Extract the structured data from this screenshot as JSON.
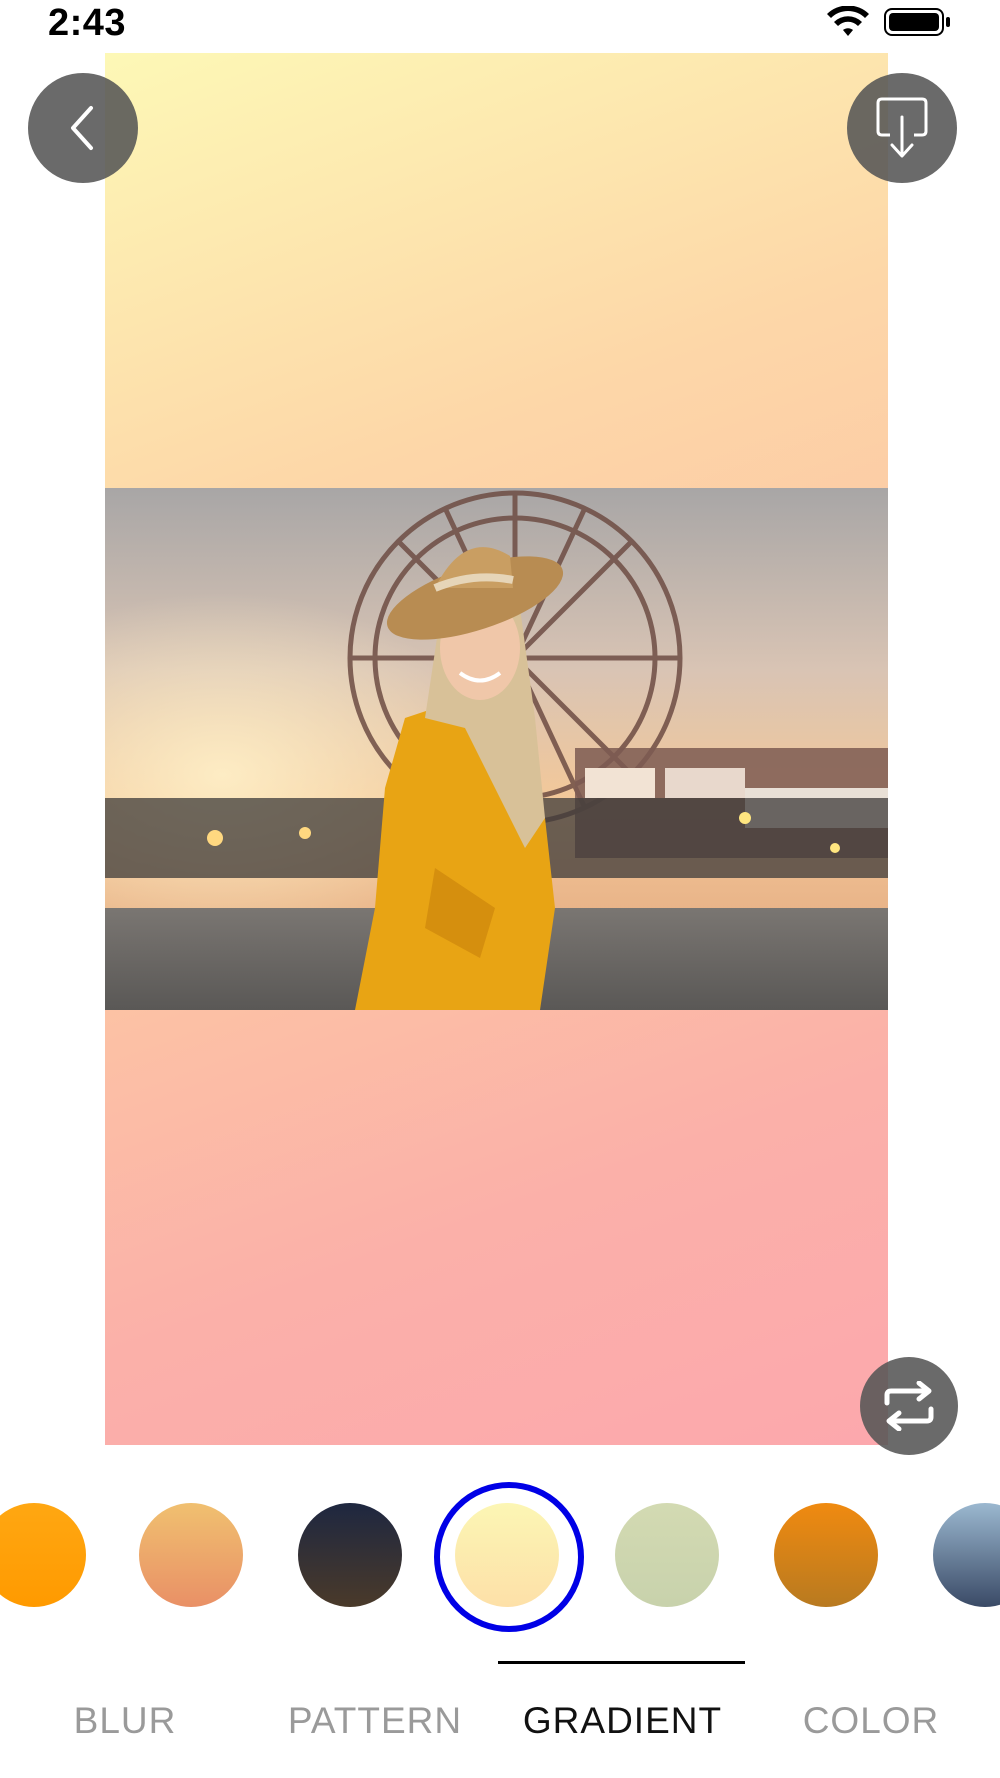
{
  "status_bar": {
    "time": "2:43"
  },
  "buttons": {
    "back": "chevron-left-icon",
    "download": "download-icon",
    "swap": "swap-icon"
  },
  "swatches": [
    {
      "name": "orange",
      "colors": [
        "#ffa712",
        "#ff9a00"
      ]
    },
    {
      "name": "peach",
      "colors": [
        "#f0c070",
        "#e99066"
      ]
    },
    {
      "name": "dark",
      "colors": [
        "#1e2740",
        "#4a3a2a"
      ]
    },
    {
      "name": "pale-yellow",
      "colors": [
        "#fcf6b4",
        "#fde0a8"
      ],
      "selected": true
    },
    {
      "name": "sage",
      "colors": [
        "#d3dab2",
        "#c8d2ac"
      ]
    },
    {
      "name": "amber",
      "colors": [
        "#f08a10",
        "#b87a20"
      ]
    },
    {
      "name": "steel-blue",
      "colors": [
        "#9bb8d0",
        "#3a4a66"
      ]
    }
  ],
  "tabs": [
    {
      "label": "BLUR",
      "active": false
    },
    {
      "label": "PATTERN",
      "active": false
    },
    {
      "label": "GRADIENT",
      "active": true
    },
    {
      "label": "COLOR",
      "active": false
    }
  ],
  "colors": {
    "accent": "#0000e6",
    "button_bg": "#555555"
  }
}
